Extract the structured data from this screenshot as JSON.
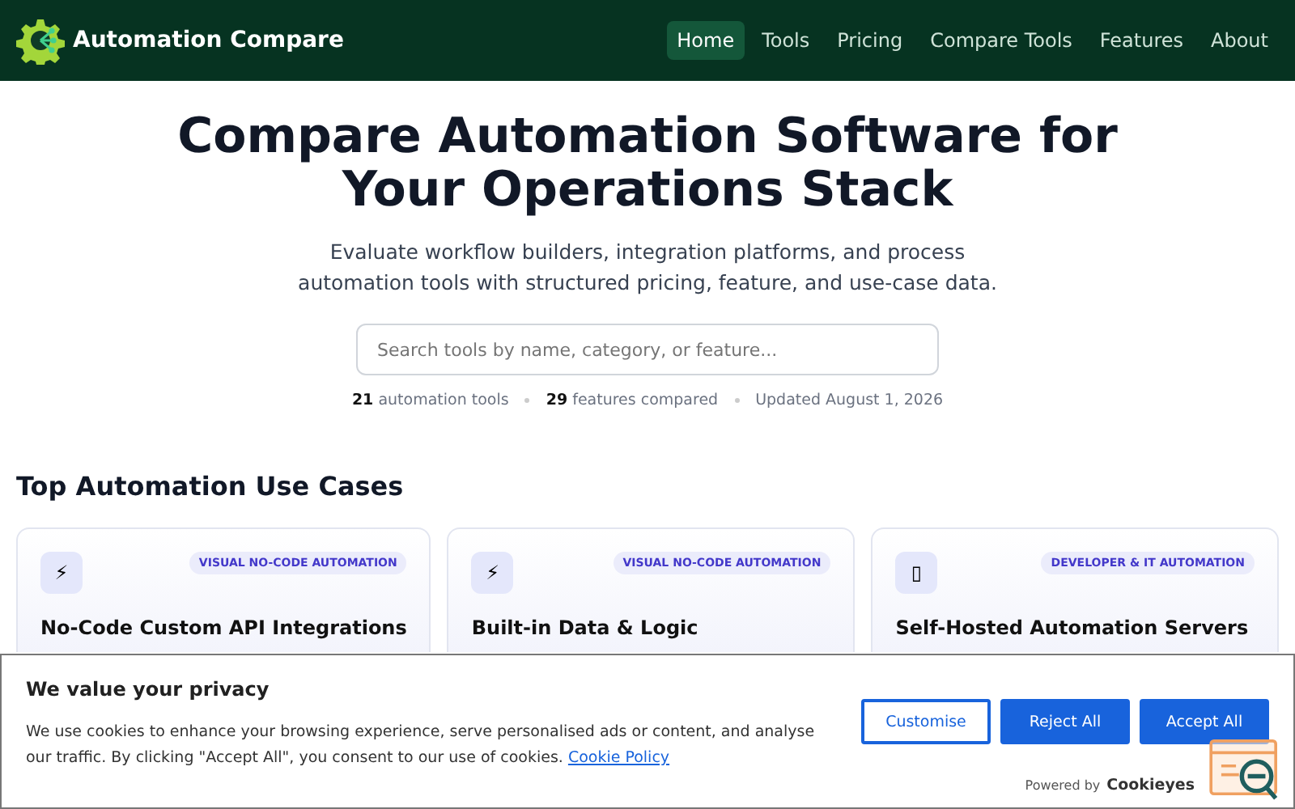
{
  "nav": {
    "brand": "Automation Compare",
    "links": [
      {
        "label": "Home",
        "selected": true
      },
      {
        "label": "Tools",
        "selected": false
      },
      {
        "label": "Pricing",
        "selected": false
      },
      {
        "label": "Compare Tools",
        "selected": false
      },
      {
        "label": "Features",
        "selected": false
      },
      {
        "label": "About",
        "selected": false
      }
    ]
  },
  "hero": {
    "title": "Compare Automation Software for Your Operations Stack",
    "subtitle": "Evaluate workflow builders, integration platforms, and process automation tools with structured pricing, feature, and use-case data.",
    "search": {
      "placeholder": "Search tools by name, category, or feature..."
    },
    "stats": [
      {
        "value": "21",
        "label": "automation tools"
      },
      {
        "value": "29",
        "label": "features compared"
      },
      {
        "label": "Updated August 1, 2026"
      }
    ]
  },
  "use_cases": {
    "heading": "Top Automation Use Cases",
    "cards": [
      {
        "icon": "⚡",
        "tag": "VISUAL NO-CODE AUTOMATION",
        "title": "No-Code Custom API Integrations"
      },
      {
        "icon": "⚡",
        "tag": "VISUAL NO-CODE AUTOMATION",
        "title": "Built-in Data & Logic"
      },
      {
        "icon": "▯",
        "tag": "DEVELOPER & IT AUTOMATION",
        "title": "Self-Hosted Automation Servers"
      }
    ]
  },
  "cookie_banner": {
    "title": "We value your privacy",
    "text": "We use cookies to enhance your browsing experience, serve personalised ads or content, and analyse our traffic. By clicking \"Accept All\", you consent to our use of cookies.",
    "link": "Cookie Policy",
    "buttons": [
      {
        "label": "Customise",
        "kind": "outline"
      },
      {
        "label": "Reject All",
        "kind": "solid"
      },
      {
        "label": "Accept All",
        "kind": "solid"
      }
    ],
    "powered_by": "Powered by",
    "brand": "Cookieyes"
  }
}
